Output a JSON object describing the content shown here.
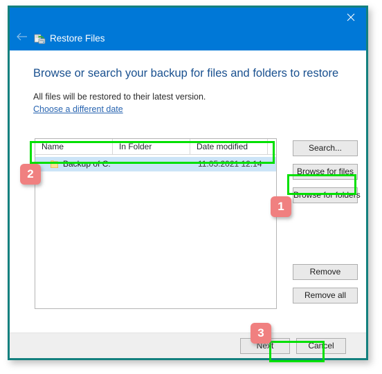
{
  "window": {
    "title": "Restore Files",
    "title_icon": "restore-files-icon",
    "back_icon": "back-arrow-icon",
    "close_icon": "close-icon",
    "titlebar_color": "#0078d7",
    "frame_color": "#13807e"
  },
  "content": {
    "heading": "Browse or search your backup for files and folders to restore",
    "subtext": "All files will be restored to their latest version.",
    "different_date_link": "Choose a different date"
  },
  "filelist": {
    "columns": [
      "Name",
      "In Folder",
      "Date modified"
    ],
    "rows": [
      {
        "icon": "folder-icon",
        "name": "Backup of C:",
        "in_folder": "",
        "date_modified": "11.05.2021 12:14",
        "selected": true,
        "selection_color": "#cce4f7"
      }
    ]
  },
  "side_buttons": {
    "search": "Search...",
    "browse_for_files": "Browse for files",
    "browse_for_folders": "Browse for folders",
    "remove": "Remove",
    "remove_all": "Remove all"
  },
  "footer_buttons": {
    "next": "Next",
    "cancel": "Cancel"
  },
  "annotations": {
    "highlight_color": "#00e000",
    "badge_color": "#f08080",
    "badges": [
      {
        "id": "1",
        "label": "1",
        "target": "browse-for-folders-button"
      },
      {
        "id": "2",
        "label": "2",
        "target": "file-list-row"
      },
      {
        "id": "3",
        "label": "3",
        "target": "next-button"
      }
    ]
  }
}
